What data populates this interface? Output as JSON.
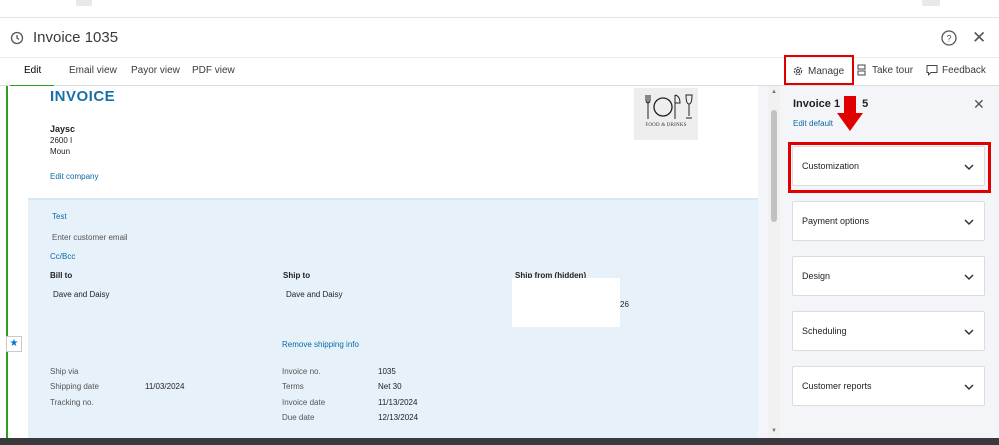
{
  "window": {
    "title": "Invoice 1035"
  },
  "tabs": [
    {
      "label": "Edit",
      "active": true
    },
    {
      "label": "Email view",
      "active": false
    },
    {
      "label": "Payor view",
      "active": false
    },
    {
      "label": "PDF view",
      "active": false
    }
  ],
  "toolbar": {
    "manage_label": "Manage",
    "tour_label": "Take tour",
    "feedback_label": "Feedback"
  },
  "invoice": {
    "heading": "INVOICE",
    "company_name": "Jaysc",
    "company_line1": "2600 I",
    "company_line2": "Moun",
    "edit_company": "Edit company",
    "logo_caption": "FOOD & DRINKS",
    "recipient_name": "Test",
    "email_placeholder": "Enter customer email",
    "cc_bcc": "Cc/Bcc",
    "bill_to_label": "Bill to",
    "bill_to_value": "Dave and Daisy",
    "ship_to_label": "Ship to",
    "ship_to_value": "Dave and Daisy",
    "ship_from_label": "Ship from (hidden)",
    "ship_from_fragment": "26",
    "remove_shipping": "Remove shipping info",
    "ship_via_label": "Ship via",
    "shipping_date_label": "Shipping date",
    "shipping_date_value": "11/03/2024",
    "tracking_label": "Tracking no.",
    "invoice_no_label": "Invoice no.",
    "invoice_no_value": "1035",
    "terms_label": "Terms",
    "terms_value": "Net 30",
    "invoice_date_label": "Invoice date",
    "invoice_date_value": "11/13/2024",
    "due_date_label": "Due date",
    "due_date_value": "12/13/2024"
  },
  "panel": {
    "title": "Invoice 1",
    "title_suffix": "5",
    "subtitle": "Edit default",
    "sections": [
      "Customization",
      "Payment options",
      "Design",
      "Scheduling",
      "Customer reports"
    ]
  },
  "colors": {
    "brand_green": "#2ca01c",
    "link_blue": "#0b6aa7",
    "highlight_red": "#e00000",
    "invoice_blue": "#1a6fa8"
  },
  "icons": {
    "history": "history-icon",
    "help": "help-icon",
    "close": "close-icon",
    "gear": "gear-icon",
    "tour": "tour-icon",
    "feedback": "feedback-icon",
    "chevron": "chevron-down-icon"
  }
}
